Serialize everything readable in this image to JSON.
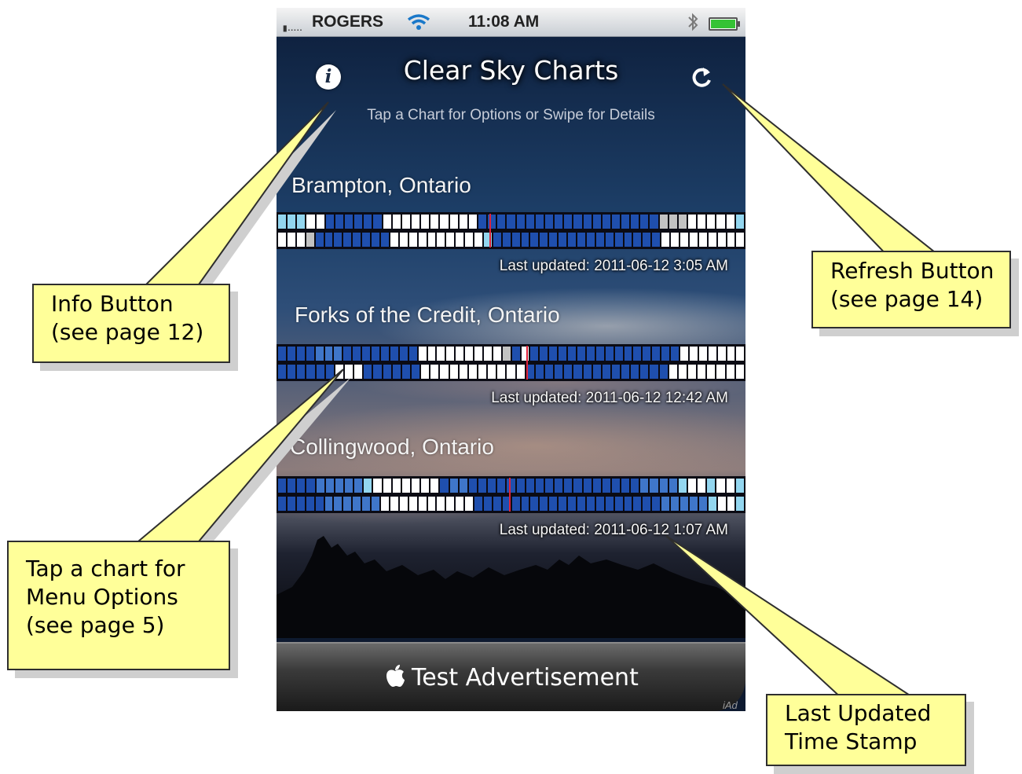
{
  "status_bar": {
    "signal_dots": "▮.....",
    "carrier": "ROGERS",
    "time": "11:08 AM"
  },
  "header": {
    "title": "Clear Sky Charts",
    "subtitle": "Tap a Chart for Options or Swipe for Details",
    "info_icon": "info-icon",
    "refresh_icon": "refresh-icon"
  },
  "locations": [
    {
      "name": "Brampton, Ontario",
      "last_updated": "Last updated: 2011-06-12 3:05 AM",
      "rows": [
        "lllwwddddddwwwwwwwwwwdddddddddddddddddddgggwwwwwl",
        "wwwgddddddddwwwwwwwwwwlddddddddddddddddddwwwwwwwww"
      ]
    },
    {
      "name": "Forks of the Credit, Ontario",
      "last_updated": "Last updated: 2011-06-12 12:42 AM",
      "rows": [
        "ddddmmmddddddddwwwwwwwwwgdwddddddddddddddddwwwwwww",
        "ddddddwwwddddddwwwwwwwwwwwdddddddddddddddwwwwwwww"
      ]
    },
    {
      "name": "Collingwood, Ontario",
      "last_updated": "Last updated: 2011-06-12 1:07 AM",
      "rows": [
        "ddddmmmmmlwwwwwwwdmmddddddddddddddddddmmmmlwwlwwl",
        "dddddmmmmmmwwwwwwwwwwddddddddddddddddddddmmmmmlwwl"
      ]
    }
  ],
  "chart_colors": {
    "d": "#1f4fae",
    "m": "#3f76c9",
    "l": "#93d6ef",
    "w": "#ffffff",
    "g": "#c2c2c2",
    "now_line": "#e0223a"
  },
  "ad": {
    "apple_icon": "",
    "text": "Test Advertisement",
    "iad_mark": "iAd"
  },
  "callouts": {
    "info": [
      "Info Button",
      "(see page 12)"
    ],
    "refresh": [
      "Refresh Button",
      "(see page 14)"
    ],
    "tap_chart": [
      "Tap a chart for",
      "Menu Options",
      "(see page 5)"
    ],
    "last_updated": [
      "Last Updated",
      "Time Stamp"
    ]
  },
  "colors": {
    "callout_fill": "#ffff99",
    "callout_border": "#2e2e2e"
  }
}
